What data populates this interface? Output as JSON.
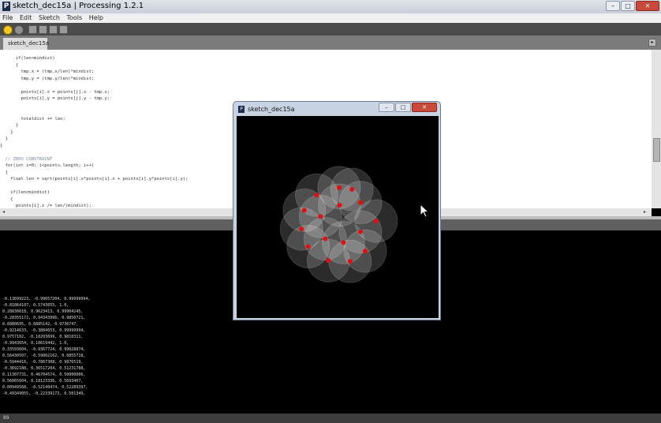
{
  "window": {
    "title": "sketch_dec15a | Processing 1.2.1",
    "app_icon": "P"
  },
  "menu": [
    "File",
    "Edit",
    "Sketch",
    "Tools",
    "Help"
  ],
  "tab": {
    "label": "sketch_dec15a §",
    "arrow_icon": "arrow-right-icon"
  },
  "code": [
    "      if(len<mindist)",
    "      {",
    "        tmp.x = (tmp.x/len)*mindist;",
    "        tmp.y = (tmp.y/len)*mindist;",
    "",
    "        points[i].x = points[j].x - tmp.x;",
    "        points[i].y = points[j].y - tmp.y;",
    "",
    "",
    "        totaldist += len;",
    "      }",
    "    }",
    "  }",
    "}",
    "",
    "  // ZERO CONSTRAINT",
    "  for(int i=0; i<points.length; i++)",
    "  {",
    "    float len = sqrt(points[i].x*points[i].x + points[i].y*points[i].y);",
    "",
    "    if(len<mindist)",
    "    {",
    "      points[i].x /= len/(mindist);"
  ],
  "console": [
    "-0.13699223, -0.99057204, 0.99999994,",
    "-0.81864107, 0.5743055, 1.0,",
    "0.28830618, 0.9623413, 0.99904245,",
    "-0.28355172, 0.94343996, 0.9850721,",
    "0.6880695, 0.6885142, 0.9736747,",
    "-0.9214633, -0.3884653, 0.99999994,",
    "0.9757102, -0.10203699, 0.9810311,",
    "-0.9943654, 0.10619442, 1.0,",
    "0.33593604, -0.9367724, 0.99028874,",
    "0.56430507, -0.59002162, 0.6855718,",
    "-0.5944416, -0.7867308, 0.9876519,",
    "-0.3692188, 0.36517204, 0.51231788,",
    "0.11307731, 0.46704574, 0.50000006,",
    "0.56065604, 0.18123336, 0.5693407,",
    "0.00949568, -0.52140474, 0.52289397,",
    "-0.49349055, -0.22339173, 0.501349,"
  ],
  "status": {
    "line_number": "89"
  },
  "sketch_window": {
    "title": "sketch_dec15a",
    "icon": "P",
    "circles": [
      [
        0.0,
        -0.985
      ],
      [
        -0.819,
        0.574
      ],
      [
        0.288,
        0.962
      ],
      [
        -0.284,
        0.943
      ],
      [
        0.688,
        0.689
      ],
      [
        -0.921,
        -0.388
      ],
      [
        0.976,
        -0.102
      ],
      [
        -0.994,
        0.106
      ],
      [
        0.336,
        -0.937
      ],
      [
        0.564,
        -0.59
      ],
      [
        -0.594,
        -0.787
      ],
      [
        -0.369,
        0.365
      ],
      [
        0.113,
        0.467
      ],
      [
        0.561,
        0.181
      ],
      [
        0.009,
        -0.521
      ],
      [
        -0.493,
        -0.223
      ]
    ]
  },
  "colors": {
    "dot": "#e01010",
    "circle_fill": "#ffffff",
    "run_button": "#f5c81f"
  },
  "icons": {
    "run": "play-icon",
    "stop": "stop-icon",
    "new": "new-file-icon",
    "open": "open-icon",
    "save": "save-icon",
    "export": "export-icon",
    "cursor": "mouse-pointer-icon"
  }
}
